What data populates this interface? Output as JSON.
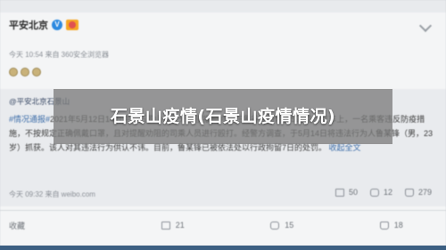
{
  "post": {
    "author": "平安北京",
    "meta": "今天 10:54 来自 360安全浏览器"
  },
  "repost": {
    "author_handle": "@平安北京石景山",
    "hashtag": "#情况通报#",
    "text": "2021年5月12日14时许，石景山公安分局接报警称：在鲁谷东街附近598路公交车上，一名乘客违反防疫措施，不按规定正确佩戴口罩，且对提醒劝阻的司乘人员进行殴打。经警方调查，于5月14日将违法行为人鲁某锋（男，23岁）抓获。该人对其违法行为供认不讳。目前，鲁某锋已被依法处以行政拘留7日的处罚。",
    "expand_label": "收起全文",
    "meta": "今天 09:32 来自 weibo.com",
    "share_count": "50",
    "comment_count": "12",
    "like_count": "279"
  },
  "actions": {
    "collect": "收藏",
    "repost": "21",
    "comment": "15",
    "like": "18"
  },
  "overlay": {
    "title": "石景山疫情(石景山疫情情况)"
  }
}
